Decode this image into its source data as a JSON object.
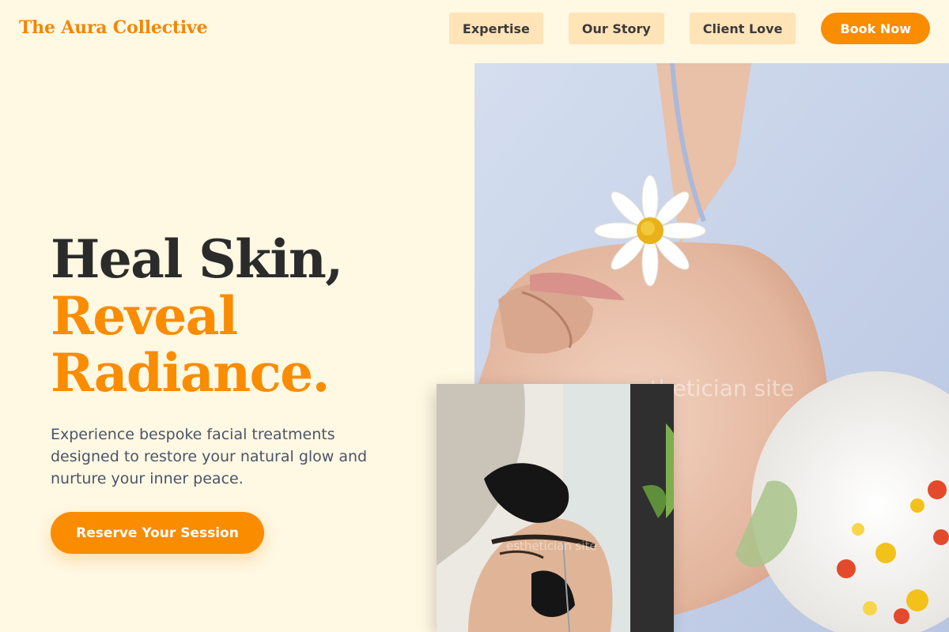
{
  "brand": {
    "name": "The Aura Collective"
  },
  "nav": {
    "items": [
      {
        "label": "Expertise"
      },
      {
        "label": "Our Story"
      },
      {
        "label": "Client Love"
      }
    ],
    "cta_label": "Book Now"
  },
  "hero": {
    "headline_line1": "Heal Skin,",
    "headline_line2": "Reveal",
    "headline_line3": "Radiance.",
    "subtitle": "Experience bespoke facial treatments designed to restore your natural glow and nurture your inner peace.",
    "cta_label": "Reserve Your Session"
  },
  "images": {
    "main_watermark": "esthetician site",
    "inset_watermark": "esthetician site"
  },
  "colors": {
    "background": "#fff8e3",
    "accent": "#fa8c00",
    "nav_button_bg": "#ffe4b8",
    "headline_dark": "#2b2b2b",
    "body_text": "#4a5568"
  }
}
